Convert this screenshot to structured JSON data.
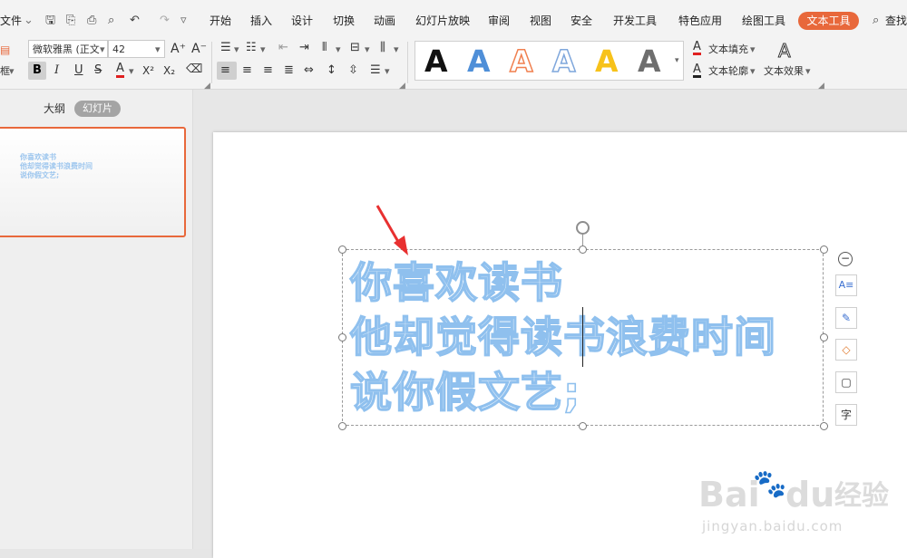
{
  "menu": {
    "file": "文件",
    "tabs": [
      "开始",
      "插入",
      "设计",
      "切换",
      "动画",
      "幻灯片放映",
      "审阅",
      "视图",
      "安全",
      "开发工具",
      "特色应用",
      "绘图工具"
    ],
    "active_tab": "文本工具",
    "search": "查找"
  },
  "ribbon": {
    "font_name": "微软雅黑 (正文",
    "font_size": "42",
    "bold": "B",
    "italic": "I",
    "underline": "U",
    "strike": "S",
    "font_color_letter": "A",
    "superscript": "X²",
    "subscript": "X₂",
    "grow": "A⁺",
    "shrink": "A⁻",
    "art_letter": "A",
    "text_fill": "文本填充",
    "text_outline": "文本轮廓",
    "text_effect": "文本效果",
    "left_clip": "框",
    "art_colors": [
      "#111111",
      "#4f8fd8",
      "#f08050",
      "#7fa7dc",
      "#f7c21a",
      "#6e6e6e"
    ]
  },
  "left_pane": {
    "tab_outline": "大纲",
    "tab_slides": "幻灯片"
  },
  "slide_text": {
    "line1": "你喜欢读书",
    "line2": "他却觉得读书浪费时间",
    "line3": "说你假文艺;"
  },
  "side_tools": {
    "collapse": "−",
    "char": "字"
  },
  "watermark": {
    "brand": "Bai",
    "brand2": "du",
    "brand3": "经验",
    "url": "jingyan.baidu.com"
  }
}
